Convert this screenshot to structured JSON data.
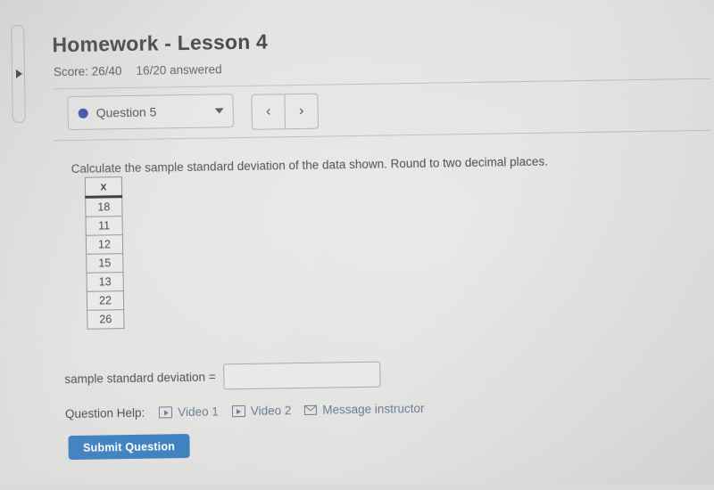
{
  "assignment": {
    "title": "Homework - Lesson 4",
    "score_label": "Score: 26/40",
    "answered_label": "16/20 answered"
  },
  "question_selector": {
    "current": "Question 5",
    "dot_color": "#3a4ba8",
    "caret_icon": "chevron-down-icon",
    "prev_label": "‹",
    "next_label": "›"
  },
  "panel": {
    "expand_icon": "triangle-right-icon"
  },
  "question": {
    "prompt": "Calculate the sample standard deviation of the data shown. Round to two decimal places.",
    "table": {
      "header": "x",
      "values": [
        "18",
        "11",
        "12",
        "15",
        "13",
        "22",
        "26"
      ]
    },
    "answer": {
      "label": "sample standard deviation =",
      "value": "",
      "placeholder": ""
    }
  },
  "help": {
    "label": "Question Help:",
    "links": [
      {
        "label": "Video 1",
        "icon": "play-video-icon"
      },
      {
        "label": "Video 2",
        "icon": "play-video-icon"
      },
      {
        "label": "Message instructor",
        "icon": "envelope-icon"
      }
    ],
    "link_color": "#6b7b95"
  },
  "submit": {
    "label": "Submit Question",
    "color": "#3b7fbe"
  }
}
